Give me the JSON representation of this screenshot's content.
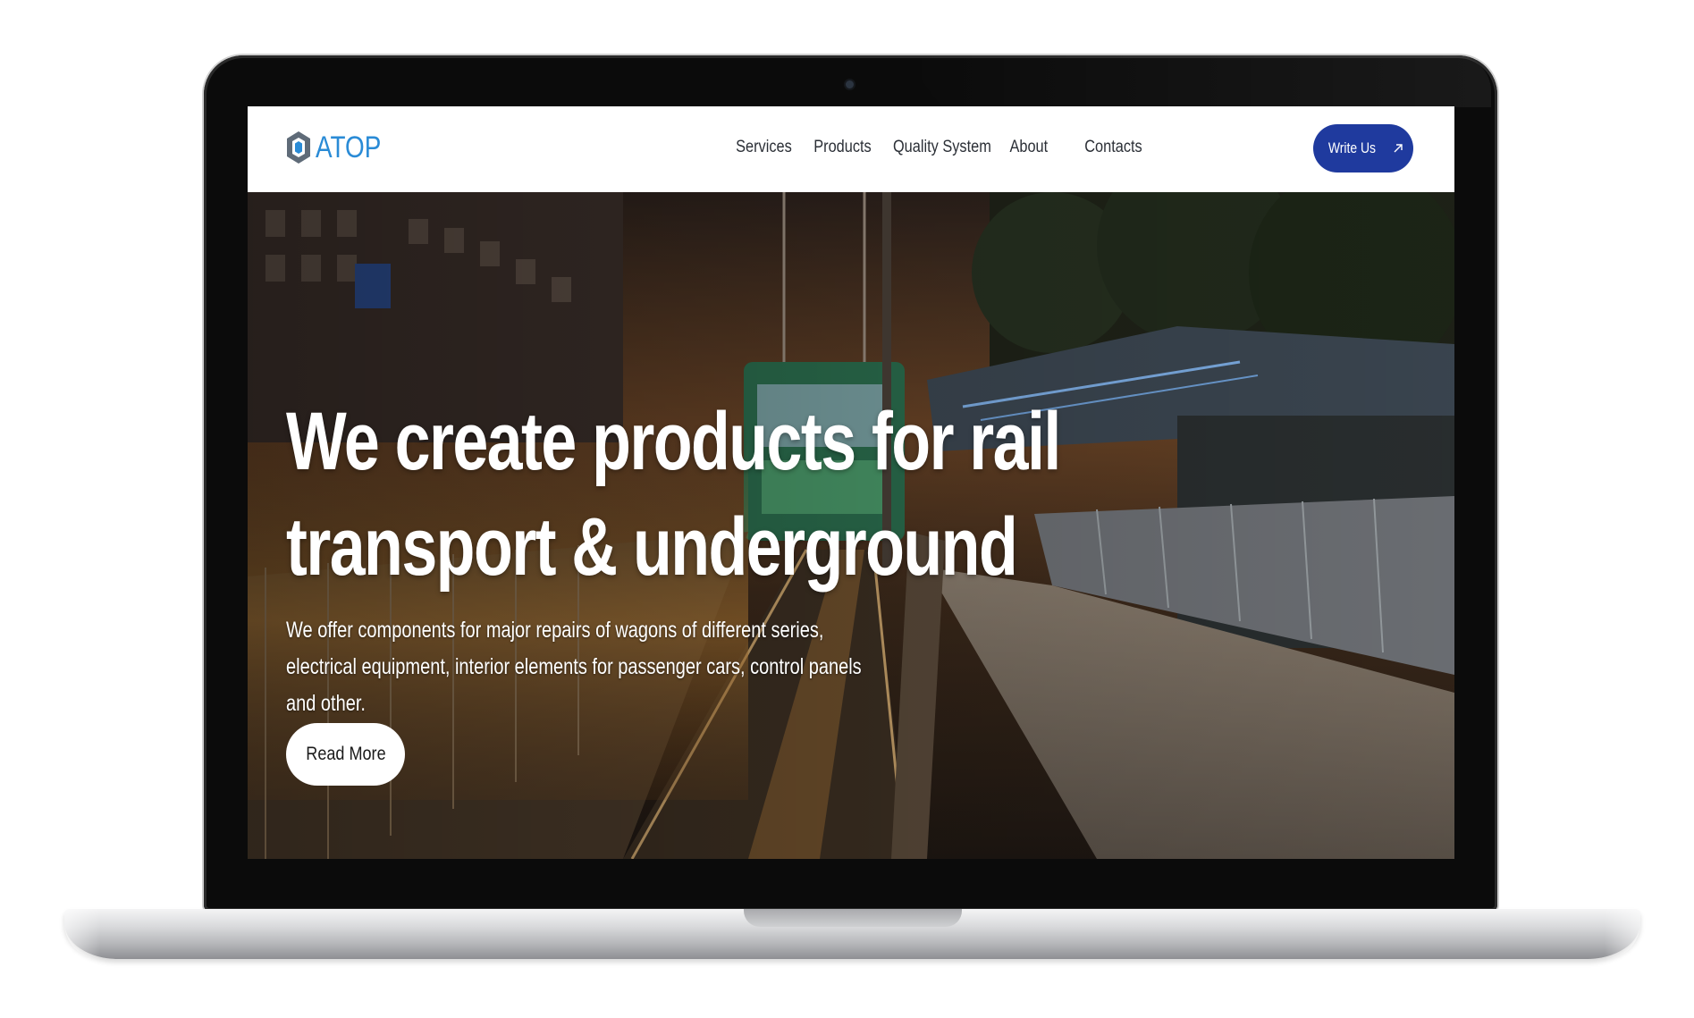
{
  "brand": {
    "name": "ATOP",
    "logo_icon": "hexagon-logo-icon",
    "color": "#2a8bd6"
  },
  "nav": {
    "items": [
      {
        "label": "Services"
      },
      {
        "label": "Products"
      },
      {
        "label": "Quality System"
      },
      {
        "label": "About"
      },
      {
        "label": "Contacts"
      }
    ],
    "cta_label": "Write Us",
    "cta_icon": "arrow-up-right-icon",
    "cta_color": "#1f3a9e"
  },
  "hero": {
    "title_line1": "We create products for rail",
    "title_line2": "transport & underground",
    "description": "We offer components for major repairs of wagons of different series, electrical equipment, interior elements for passenger cars, control panels and other.",
    "button_label": "Read More"
  }
}
